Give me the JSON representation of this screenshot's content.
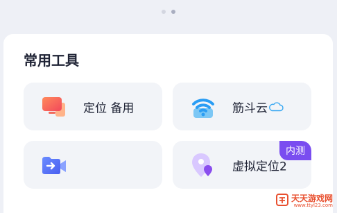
{
  "pager": {
    "total": 2,
    "active_index": 1
  },
  "section": {
    "title": "常用工具"
  },
  "tools": [
    {
      "label": "定位 备用",
      "icon": "monitor-icon"
    },
    {
      "label": "筋斗云",
      "icon": "wifi-icon",
      "suffix_icon": "cloud-icon"
    },
    {
      "label": "",
      "icon": "video-share-icon"
    },
    {
      "label": "虚拟定位2",
      "icon": "location-pin-icon",
      "badge": "内测"
    }
  ],
  "watermark": {
    "name": "天天游戏网",
    "url": "www.ttyl23.com"
  },
  "colors": {
    "accent": "#7a4df0",
    "tile_bg": "#f2f4f8",
    "page_bg": "#eef0f6"
  }
}
